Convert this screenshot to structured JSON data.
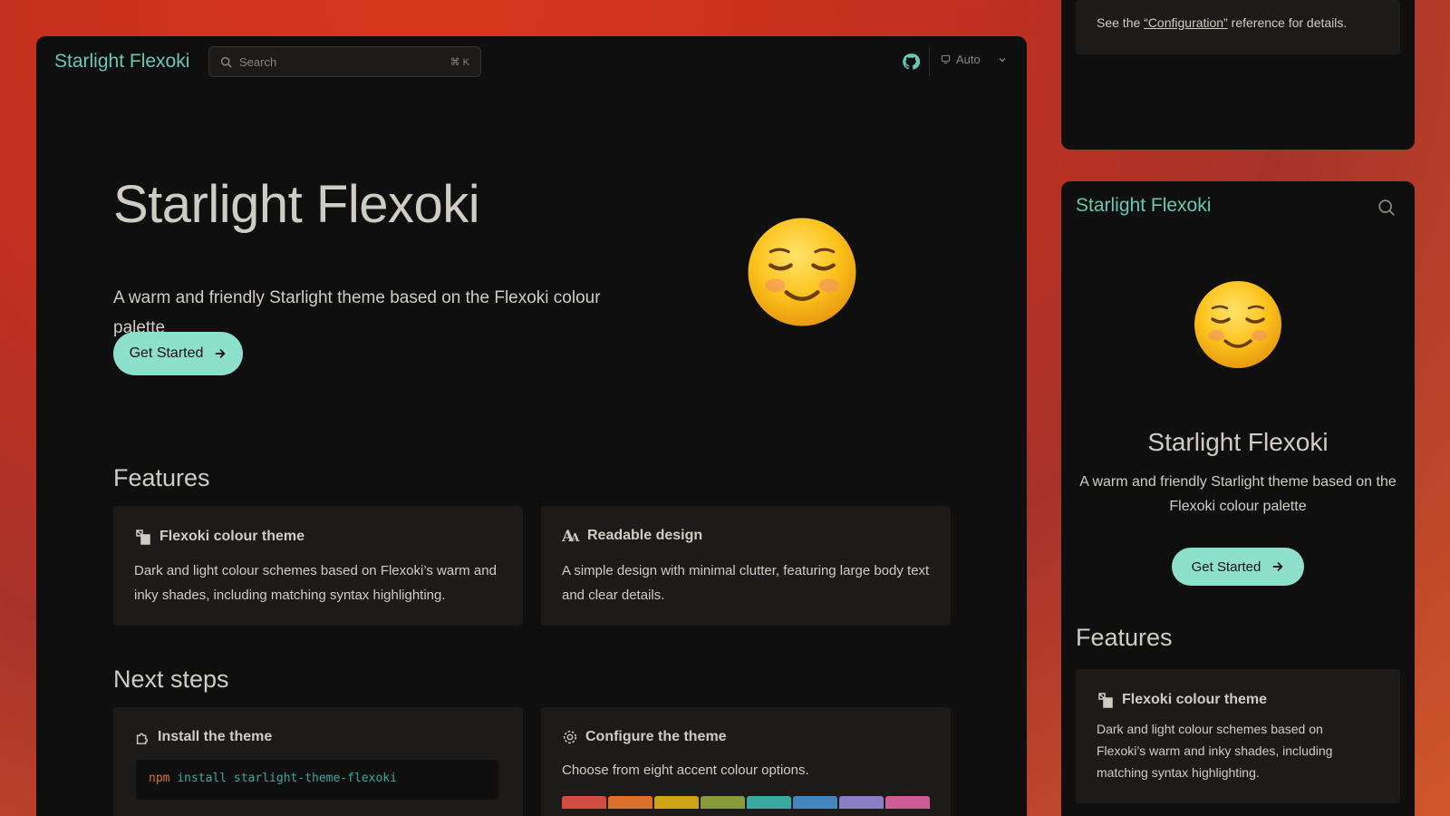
{
  "colors": {
    "accent": "#66c9b1",
    "button": "#8ce0cc",
    "background": "#100f0f",
    "card": "#1c1b1a",
    "text": "#cecdc3",
    "muted": "#878580"
  },
  "header": {
    "site_title": "Starlight Flexoki",
    "search_placeholder": "Search",
    "search_shortcut": "⌘ K",
    "theme_label": "Auto",
    "icons": [
      "search-icon",
      "github-icon",
      "monitor-icon",
      "chevron-down-icon"
    ]
  },
  "hero": {
    "title": "Starlight Flexoki",
    "tagline": "A warm and friendly Starlight theme based on the Flexoki colour palette",
    "cta": "Get Started",
    "emoji": "☺️"
  },
  "features": {
    "heading": "Features",
    "cards": [
      {
        "icon": "palette-icon",
        "title": "Flexoki colour theme",
        "body": "Dark and light colour schemes based on Flexoki’s warm and inky shades, including matching syntax highlighting."
      },
      {
        "icon": "font-icon",
        "title": "Readable design",
        "body": "A simple design with minimal clutter, featuring large body text and clear details."
      }
    ]
  },
  "next_steps": {
    "heading": "Next steps",
    "install": {
      "title": "Install the theme",
      "code_cmd": "npm",
      "code_rest": "install starlight-theme-flexoki"
    },
    "configure": {
      "title": "Configure the theme",
      "body": "Choose from eight accent colour options.",
      "swatches": [
        "#d14d41",
        "#da702c",
        "#d0a215",
        "#879a39",
        "#3aa99f",
        "#4385be",
        "#8b7ec8",
        "#ce5d97"
      ]
    }
  },
  "side_top": {
    "note_prefix": "See the ",
    "note_link": "“Configuration”",
    "note_suffix": " reference for details."
  },
  "mobile": {
    "site_title": "Starlight Flexoki",
    "hero_title": "Starlight Flexoki",
    "tagline": "A warm and friendly Starlight theme based on the Flexoki colour palette",
    "cta": "Get Started",
    "features_heading": "Features",
    "card_title": "Flexoki colour theme",
    "card_body": "Dark and light colour schemes based on Flexoki’s warm and inky shades, including matching syntax highlighting."
  }
}
